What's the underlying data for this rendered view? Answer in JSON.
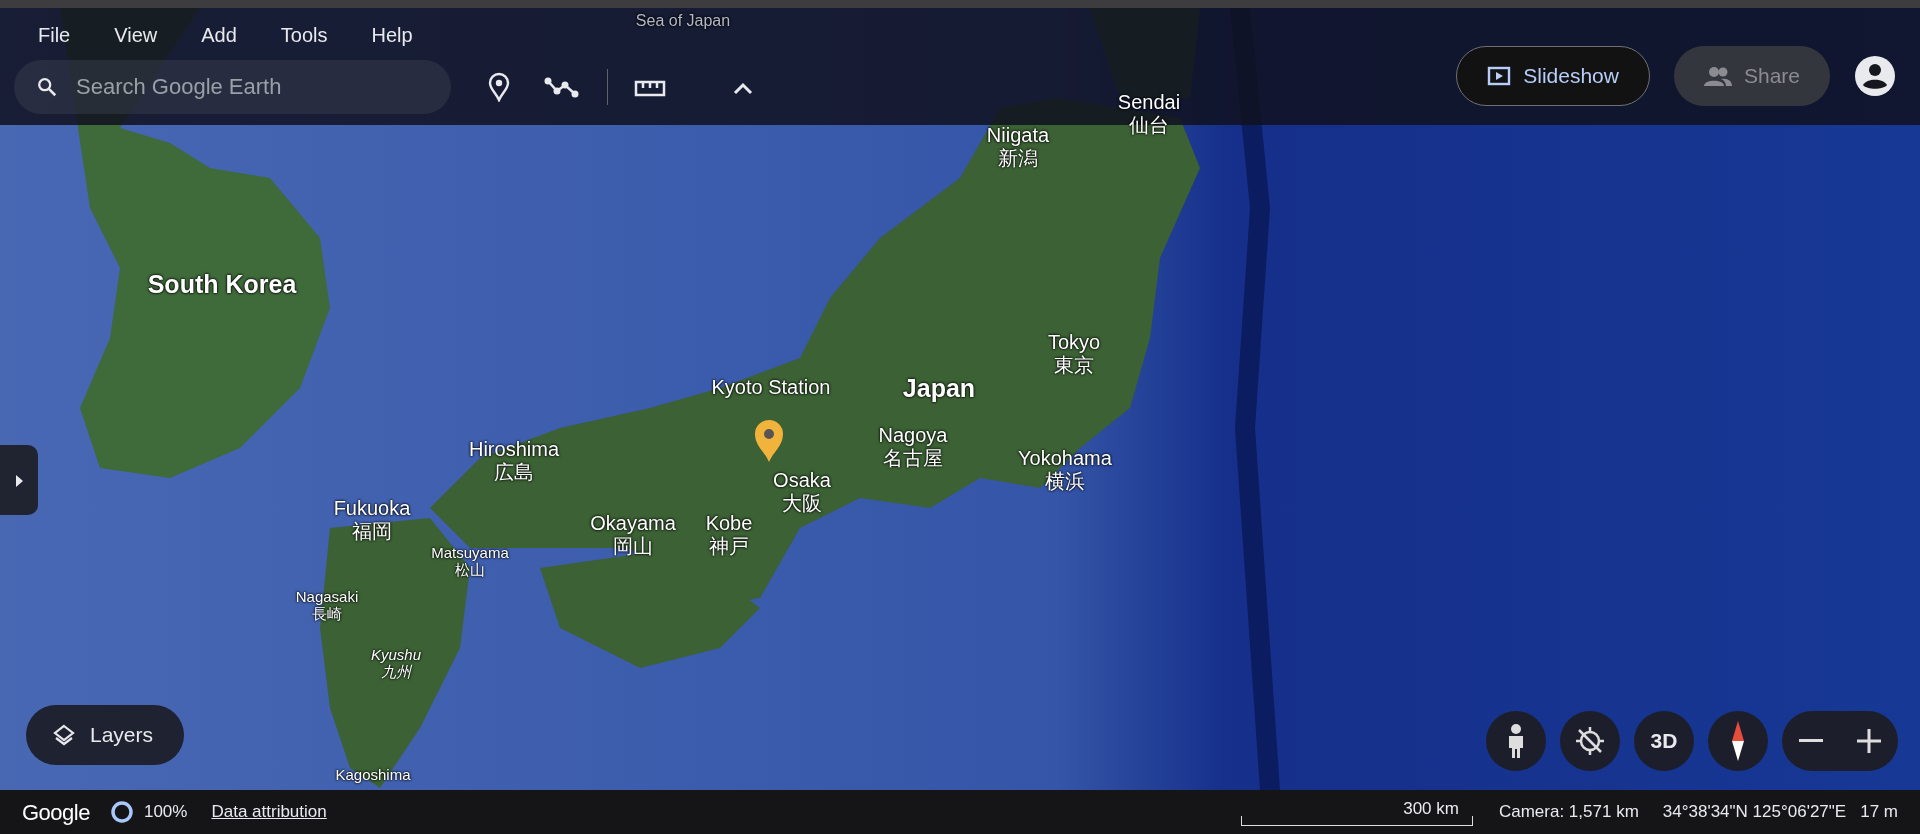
{
  "menu": [
    {
      "label": "File"
    },
    {
      "label": "View"
    },
    {
      "label": "Add"
    },
    {
      "label": "Tools"
    },
    {
      "label": "Help"
    }
  ],
  "search": {
    "placeholder": "Search Google Earth"
  },
  "slideshow": {
    "label": "Slideshow"
  },
  "share": {
    "label": "Share",
    "disabled": true
  },
  "map_labels": [
    {
      "kind": "sea",
      "name": "Sea of Japan"
    },
    {
      "kind": "city",
      "name": "Sendai",
      "native": "仙台"
    },
    {
      "kind": "city",
      "name": "Niigata",
      "native": "新潟"
    },
    {
      "kind": "country",
      "name": "South Korea"
    },
    {
      "kind": "place",
      "name": "Kyoto Station"
    },
    {
      "kind": "country",
      "name": "Japan"
    },
    {
      "kind": "city",
      "name": "Tokyo",
      "native": "東京"
    },
    {
      "kind": "city",
      "name": "Hiroshima",
      "native": "広島"
    },
    {
      "kind": "city",
      "name": "Nagoya",
      "native": "名古屋"
    },
    {
      "kind": "city",
      "name": "Yokohama",
      "native": "横浜"
    },
    {
      "kind": "city",
      "name": "Osaka",
      "native": "大阪"
    },
    {
      "kind": "city",
      "name": "Fukuoka",
      "native": "福岡"
    },
    {
      "kind": "city",
      "name": "Okayama",
      "native": "岡山"
    },
    {
      "kind": "city",
      "name": "Kobe",
      "native": "神戸"
    },
    {
      "kind": "small",
      "name": "Matsuyama",
      "native": "松山"
    },
    {
      "kind": "small",
      "name": "Nagasaki",
      "native": "長崎"
    },
    {
      "kind": "region",
      "name": "Kyushu",
      "native": "九州"
    },
    {
      "kind": "small",
      "name": "Kagoshima"
    }
  ],
  "layers": {
    "label": "Layers"
  },
  "view_controls": {
    "mode_label": "3D"
  },
  "footer": {
    "logo": "Google",
    "loading": "100%",
    "attribution": "Data attribution",
    "scale": "300 km",
    "camera": "Camera: 1,571 km",
    "coordinates": "34°38'34\"N 125°06'27\"E",
    "elevation": "17 m"
  }
}
